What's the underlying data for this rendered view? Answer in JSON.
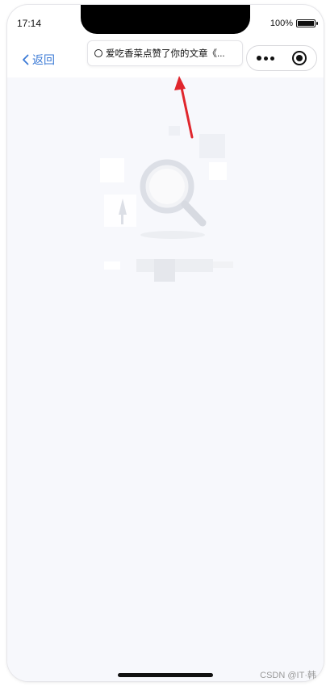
{
  "status_bar": {
    "time": "17:14",
    "battery_text": "100%",
    "battery_level": 1.0
  },
  "navbar": {
    "back_label": "返回",
    "back_icon": "chevron-left-icon"
  },
  "toast": {
    "text": "爱吃香菜点赞了你的文章《..."
  },
  "capsule": {
    "more_icon": "more-dots-icon",
    "close_icon": "target-icon"
  },
  "empty_state": {
    "icon": "search-icon"
  },
  "watermark": {
    "text": "CSDN @IT·韩"
  },
  "colors": {
    "accent": "#3b7ad6",
    "background": "#f7f8fc",
    "arrow": "#e0262d"
  }
}
